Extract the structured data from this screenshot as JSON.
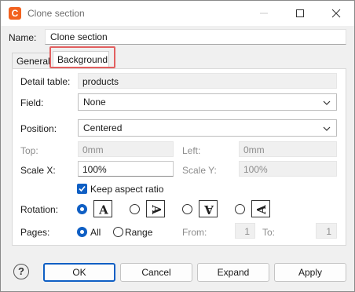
{
  "window": {
    "title": "Clone section",
    "app_icon_letter": "C"
  },
  "name": {
    "label": "Name:",
    "value": "Clone section"
  },
  "tabs": [
    {
      "label": "General"
    },
    {
      "label": "Background"
    }
  ],
  "background": {
    "detail_table": {
      "label": "Detail table:",
      "value": "products"
    },
    "field": {
      "label": "Field:",
      "value": "None"
    },
    "position": {
      "label": "Position:",
      "value": "Centered"
    },
    "top": {
      "label": "Top:",
      "value": "0mm"
    },
    "left": {
      "label": "Left:",
      "value": "0mm"
    },
    "scale_x": {
      "label": "Scale X:",
      "value": "100%"
    },
    "scale_y": {
      "label": "Scale Y:",
      "value": "100%"
    },
    "keep_aspect": {
      "label": "Keep aspect ratio",
      "checked": true
    },
    "rotation": {
      "label": "Rotation:",
      "options": [
        "A",
        "A",
        "A",
        "A"
      ],
      "selected_index": 0
    },
    "pages": {
      "label": "Pages:",
      "all_label": "All",
      "range_label": "Range",
      "selected": "All",
      "from_label": "From:",
      "from_value": "1",
      "to_label": "To:",
      "to_value": "1"
    }
  },
  "buttons": {
    "ok": "OK",
    "cancel": "Cancel",
    "expand": "Expand",
    "apply": "Apply"
  },
  "icons": {
    "help": "?"
  },
  "colors": {
    "accent": "#0f5fc4",
    "highlight": "#e26060",
    "app_icon": "#f2621f"
  }
}
